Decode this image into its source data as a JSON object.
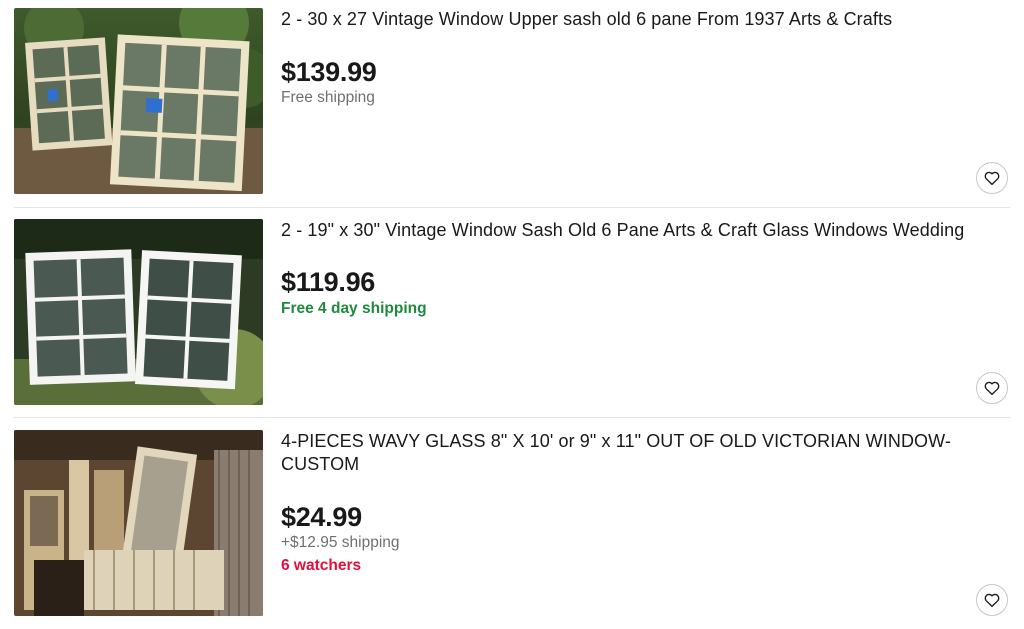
{
  "listings": [
    {
      "title": "2 - 30 x 27 Vintage Window Upper sash old 6 pane From 1937 Arts & Crafts",
      "price": "$139.99",
      "shipping": "Free shipping",
      "image_icon": "listing-photo",
      "favorite_icon": "heart-icon"
    },
    {
      "title": "2 - 19\" x 30\" Vintage Window Sash Old 6 Pane Arts & Craft Glass Windows Wedding",
      "price": "$119.96",
      "shipping": "Free 4 day shipping",
      "image_icon": "listing-photo",
      "favorite_icon": "heart-icon"
    },
    {
      "title": "4-PIECES WAVY GLASS 8\" X 10' or 9\" x 11\" OUT OF OLD VICTORIAN WINDOW-CUSTOM",
      "price": "$24.99",
      "shipping": "+$12.95 shipping",
      "watchers": "6 watchers",
      "image_icon": "listing-photo",
      "favorite_icon": "heart-icon"
    }
  ],
  "colors": {
    "free_fast_shipping": "#1f8a3e",
    "watchers": "#e0103a",
    "secondary_text": "#707070"
  }
}
